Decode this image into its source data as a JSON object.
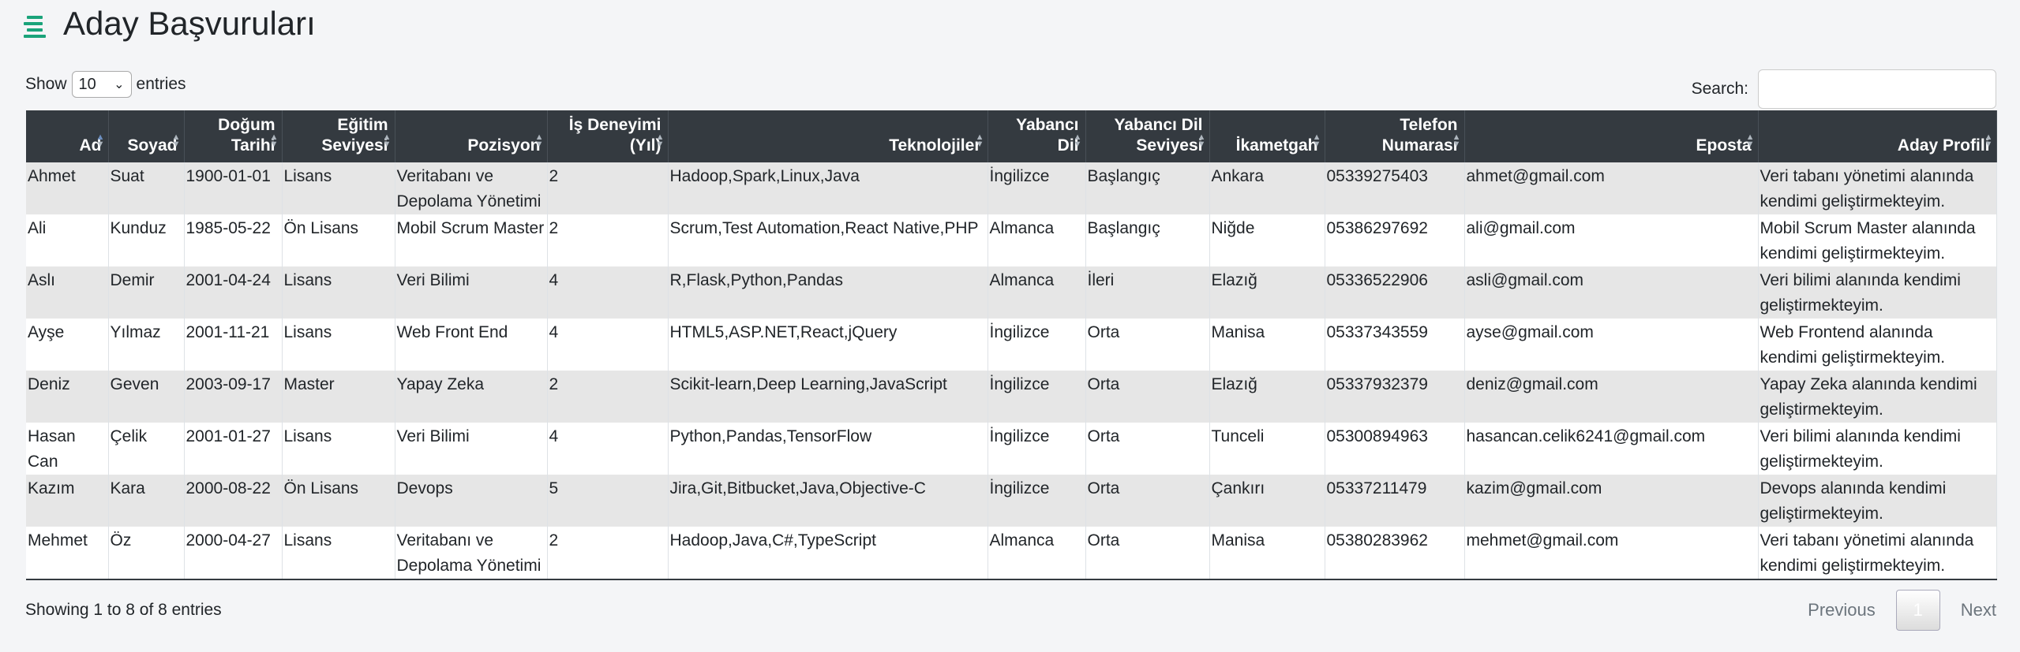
{
  "header": {
    "title": "Aday Başvuruları",
    "icon": "menu-lines-icon",
    "accent": "#1aa37a"
  },
  "length": {
    "show": "Show",
    "value": "10",
    "entries": "entries"
  },
  "search": {
    "label": "Search:",
    "value": ""
  },
  "columns": [
    "Ad",
    "Soyad",
    "Doğum Tarihi",
    "Eğitim Seviyesi",
    "Pozisyon",
    "İş Deneyimi (Yıl)",
    "Teknolojiler",
    "Yabancı Dil",
    "Yabancı Dil Seviyesi",
    "İkametgah",
    "Telefon Numarası",
    "Eposta",
    "Aday Profili"
  ],
  "rows": [
    [
      "Ahmet",
      "Suat",
      "1900-01-01",
      "Lisans",
      "Veritabanı ve Depolama Yönetimi",
      "2",
      "Hadoop,Spark,Linux,Java",
      "İngilizce",
      "Başlangıç",
      "Ankara",
      "05339275403",
      "ahmet@gmail.com",
      "Veri tabanı yönetimi alanında kendimi geliştirmekteyim."
    ],
    [
      "Ali",
      "Kunduz",
      "1985-05-22",
      "Ön Lisans",
      "Mobil Scrum Master",
      "2",
      "Scrum,Test Automation,React Native,PHP",
      "Almanca",
      "Başlangıç",
      "Niğde",
      "05386297692",
      "ali@gmail.com",
      "Mobil Scrum Master alanında kendimi geliştirmekteyim."
    ],
    [
      "Aslı",
      "Demir",
      "2001-04-24",
      "Lisans",
      "Veri Bilimi",
      "4",
      "R,Flask,Python,Pandas",
      "Almanca",
      "İleri",
      "Elazığ",
      "05336522906",
      "asli@gmail.com",
      "Veri bilimi alanında kendimi geliştirmekteyim."
    ],
    [
      "Ayşe",
      "Yılmaz",
      "2001-11-21",
      "Lisans",
      "Web Front End",
      "4",
      "HTML5,ASP.NET,React,jQuery",
      "İngilizce",
      "Orta",
      "Manisa",
      "05337343559",
      "ayse@gmail.com",
      "Web Frontend alanında kendimi geliştirmekteyim."
    ],
    [
      "Deniz",
      "Geven",
      "2003-09-17",
      "Master",
      "Yapay Zeka",
      "2",
      "Scikit-learn,Deep Learning,JavaScript",
      "İngilizce",
      "Orta",
      "Elazığ",
      "05337932379",
      "deniz@gmail.com",
      "Yapay Zeka alanında kendimi geliştirmekteyim."
    ],
    [
      "Hasan Can",
      "Çelik",
      "2001-01-27",
      "Lisans",
      "Veri Bilimi",
      "4",
      "Python,Pandas,TensorFlow",
      "İngilizce",
      "Orta",
      "Tunceli",
      "05300894963",
      "hasancan.celik6241@gmail.com",
      "Veri bilimi alanında kendimi geliştirmekteyim."
    ],
    [
      "Kazım",
      "Kara",
      "2000-08-22",
      "Ön Lisans",
      "Devops",
      "5",
      "Jira,Git,Bitbucket,Java,Objective-C",
      "İngilizce",
      "Orta",
      "Çankırı",
      "05337211479",
      "kazim@gmail.com",
      "Devops alanında kendimi geliştirmekteyim."
    ],
    [
      "Mehmet",
      "Öz",
      "2000-04-27",
      "Lisans",
      "Veritabanı ve Depolama Yönetimi",
      "2",
      "Hadoop,Java,C#,TypeScript",
      "Almanca",
      "Orta",
      "Manisa",
      "05380283962",
      "mehmet@gmail.com",
      "Veri tabanı yönetimi alanında kendimi geliştirmekteyim."
    ]
  ],
  "footer": {
    "info": "Showing 1 to 8 of 8 entries",
    "previous": "Previous",
    "page": "1",
    "next": "Next"
  }
}
